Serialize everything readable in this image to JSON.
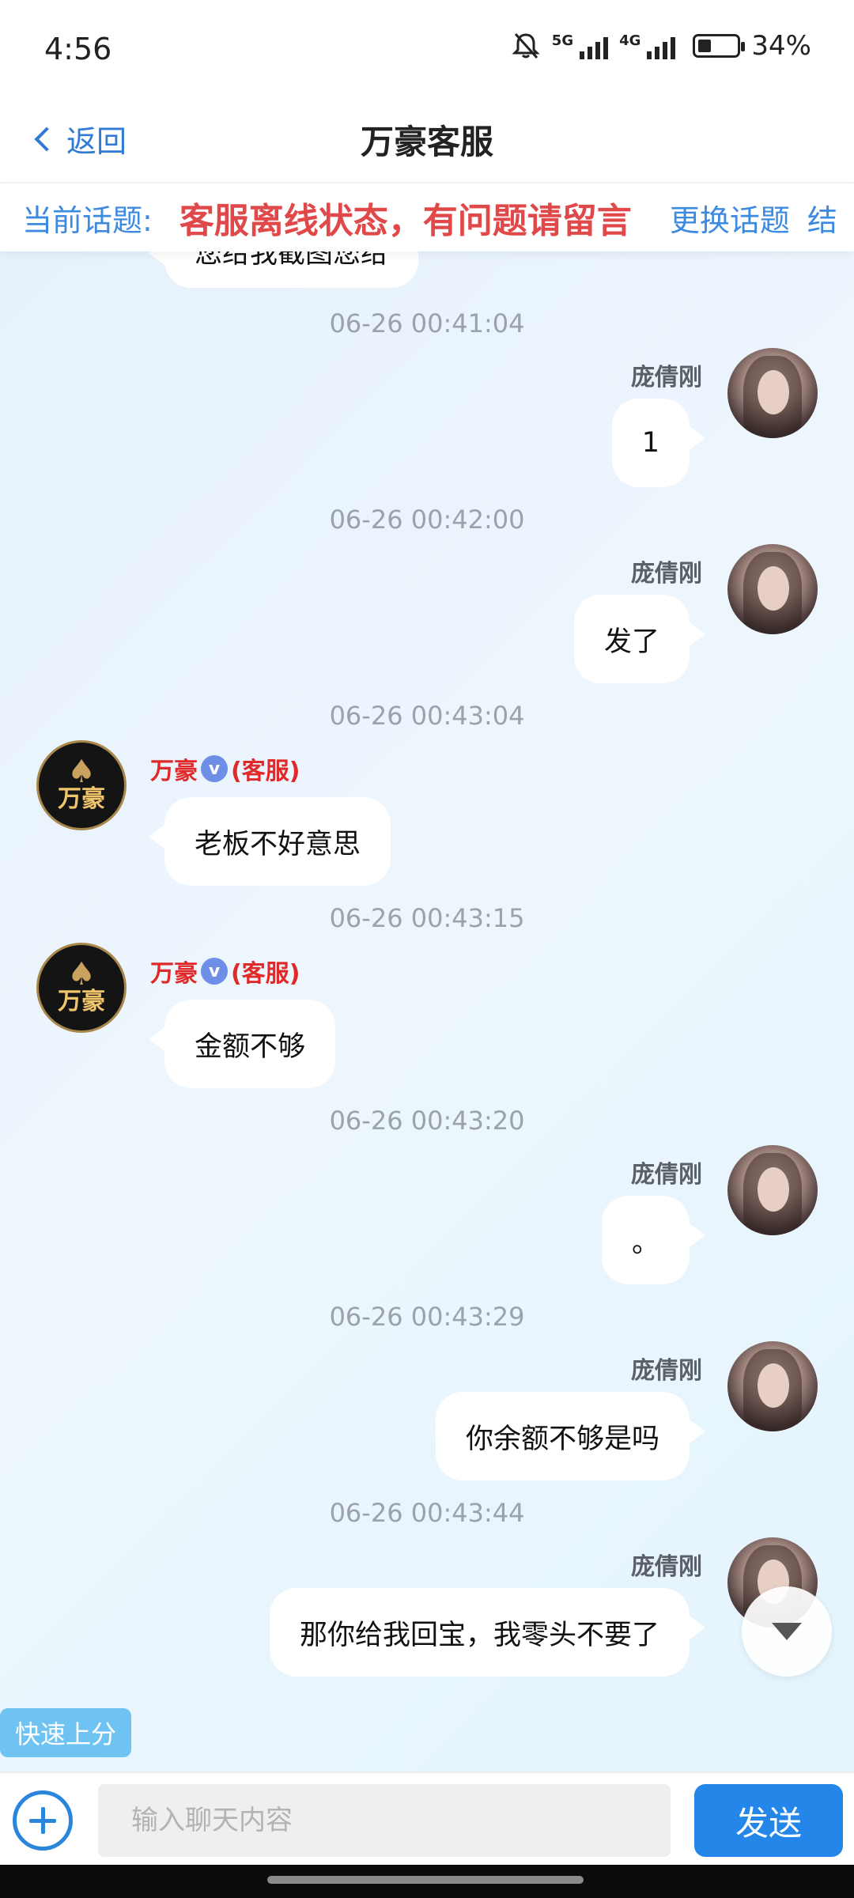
{
  "status_bar": {
    "time": "4:56",
    "net1": "5G",
    "net2": "4G",
    "battery": "34%"
  },
  "nav": {
    "back_label": "返回",
    "title": "万豪客服"
  },
  "topic": {
    "label": "当前话题:",
    "text": "客服离线状态，有问题请留言",
    "change_label": "更换话题",
    "overflow_text": "结"
  },
  "messages": [
    {
      "side": "left",
      "text": "您给我截图您给",
      "partial": true
    },
    {
      "time": "06-26 00:41:04",
      "side": "right",
      "sender": "庞倩刚",
      "text": "1"
    },
    {
      "time": "06-26 00:42:00",
      "side": "right",
      "sender": "庞倩刚",
      "text": "发了"
    },
    {
      "time": "06-26 00:43:04",
      "side": "left",
      "sender": "万豪",
      "role": "(客服)",
      "text": "老板不好意思"
    },
    {
      "time": "06-26 00:43:15",
      "side": "left",
      "sender": "万豪",
      "role": "(客服)",
      "text": "金额不够"
    },
    {
      "time": "06-26 00:43:20",
      "side": "right",
      "sender": "庞倩刚",
      "text": "。"
    },
    {
      "time": "06-26 00:43:29",
      "side": "right",
      "sender": "庞倩刚",
      "text": "你余额不够是吗"
    },
    {
      "time": "06-26 00:43:44",
      "side": "right",
      "sender": "庞倩刚",
      "text": "那你给我回宝，我零头不要了"
    }
  ],
  "service_avatar_text": "万豪",
  "verified_mark": "v",
  "quick_button": "快速上分",
  "input": {
    "placeholder": "输入聊天内容",
    "value": ""
  },
  "send_label": "发送",
  "icons": [
    "mute-bell-icon",
    "signal-icon",
    "battery-icon",
    "back-chevron-icon",
    "verified-icon",
    "scroll-down-icon",
    "plus-icon"
  ],
  "colors": {
    "accent": "#2386e8",
    "topic_warning": "#e0484a",
    "service_name": "#e02929",
    "quick_button": "#6fc3f2"
  }
}
